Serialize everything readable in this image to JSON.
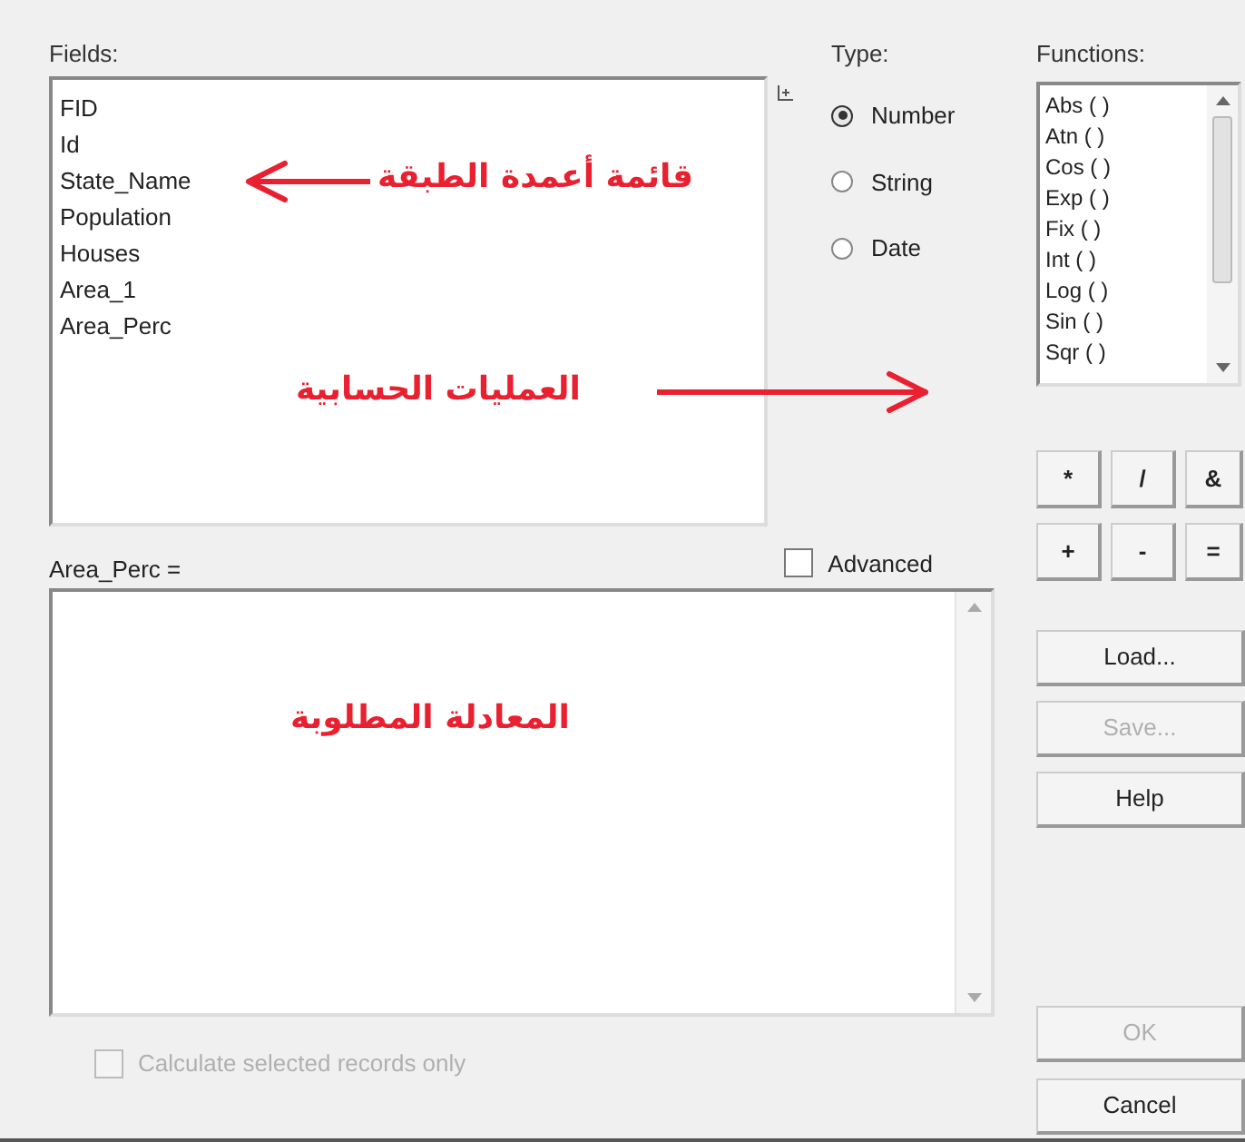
{
  "fields": {
    "label": "Fields:",
    "items": [
      "FID",
      "Id",
      "State_Name",
      "Population",
      "Houses",
      "Area_1",
      "Area_Perc"
    ]
  },
  "type": {
    "label": "Type:",
    "options": [
      {
        "label": "Number",
        "selected": true
      },
      {
        "label": "String",
        "selected": false
      },
      {
        "label": "Date",
        "selected": false
      }
    ]
  },
  "functions": {
    "label": "Functions:",
    "items": [
      "Abs ( )",
      "Atn ( )",
      "Cos ( )",
      "Exp ( )",
      "Fix ( )",
      "Int ( )",
      "Log ( )",
      "Sin ( )",
      "Sqr ( )"
    ]
  },
  "operators": [
    "*",
    "/",
    "&",
    "+",
    "-",
    "="
  ],
  "expression": {
    "label": "Area_Perc =",
    "advanced": {
      "label": "Advanced",
      "checked": false
    }
  },
  "selected_only": {
    "label": "Calculate selected records only",
    "checked": false,
    "disabled": true
  },
  "buttons": [
    {
      "label": "Load...",
      "disabled": false
    },
    {
      "label": "Save...",
      "disabled": true
    },
    {
      "label": "Help",
      "disabled": false
    }
  ],
  "dialog_buttons": [
    {
      "label": "OK",
      "disabled": true
    },
    {
      "label": "Cancel",
      "disabled": false
    }
  ],
  "annotations": [
    {
      "text": "قائمة أعمدة الطبقة"
    },
    {
      "text": "العمليات الحسابية"
    },
    {
      "text": "المعادلة المطلوبة"
    }
  ]
}
